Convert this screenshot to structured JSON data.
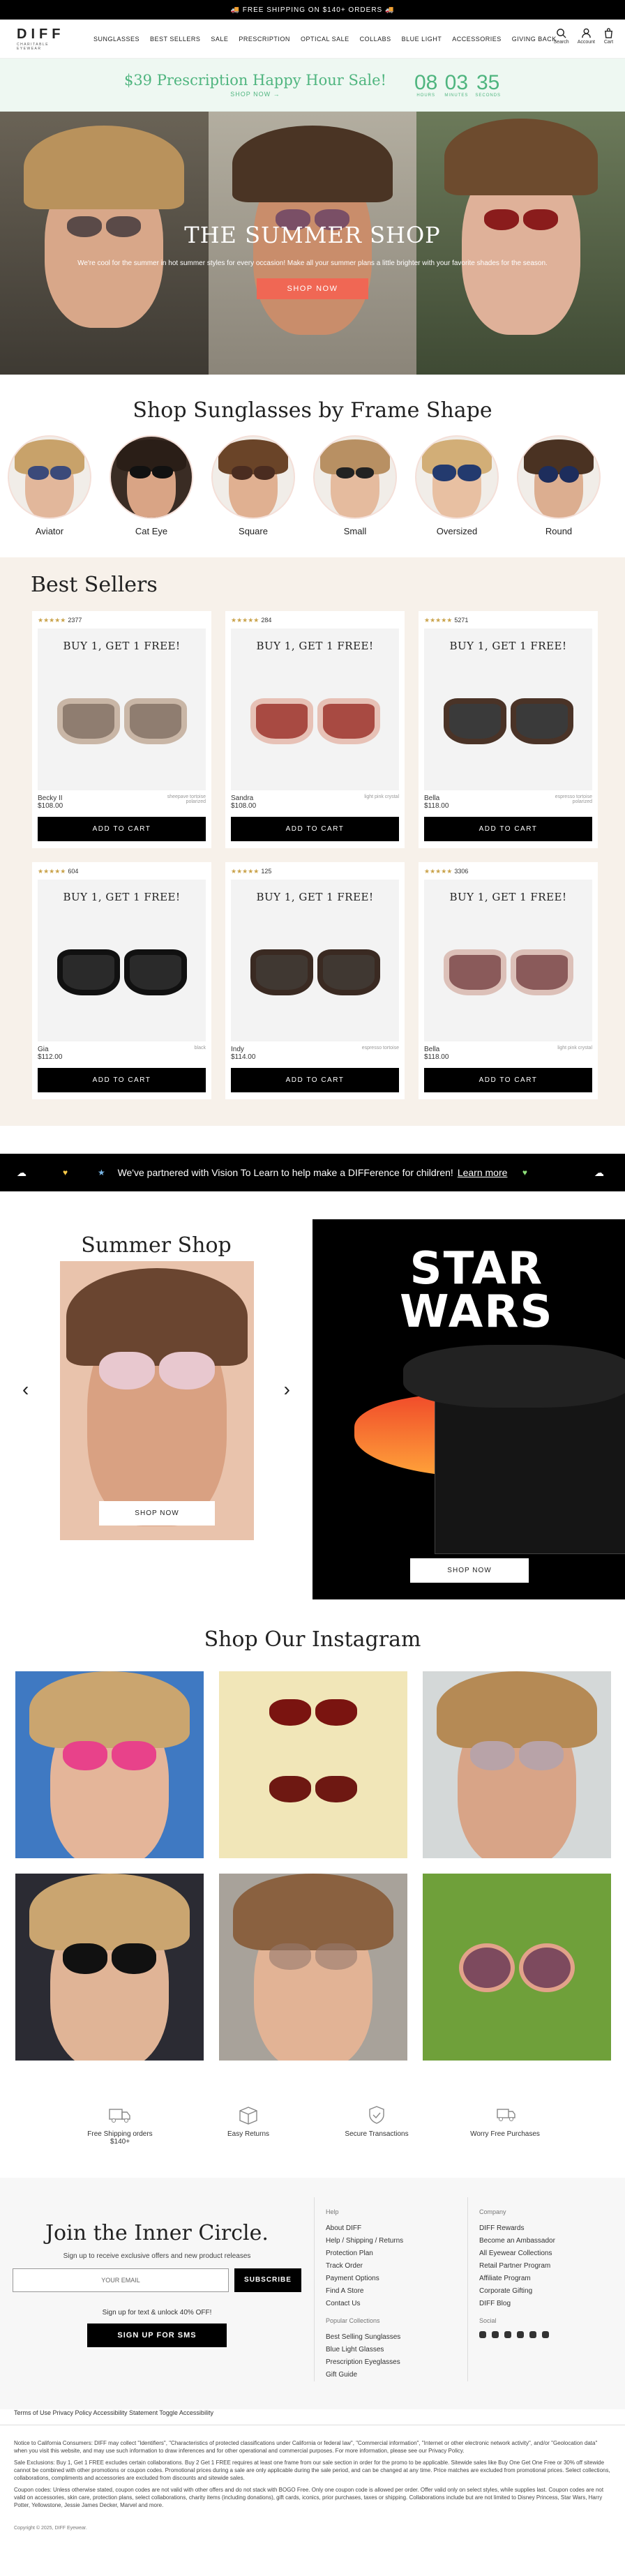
{
  "announcement": "🚚 FREE SHIPPING ON $140+ ORDERS 🚚",
  "brand": {
    "name": "DIFF",
    "tagline": "CHARITABLE EYEWEAR"
  },
  "nav": [
    "SUNGLASSES",
    "BEST SELLERS",
    "SALE",
    "PRESCRIPTION",
    "OPTICAL SALE",
    "COLLABS",
    "BLUE LIGHT",
    "ACCESSORIES",
    "GIVING BACK"
  ],
  "header_icons": {
    "search": "Search",
    "account": "Account",
    "cart": "Cart"
  },
  "promo": {
    "title": "$39 Prescription Happy Hour Sale!",
    "cta": "SHOP NOW →",
    "countdown": [
      {
        "n": "08",
        "l": "HOURS"
      },
      {
        "n": "03",
        "l": "MINUTES"
      },
      {
        "n": "35",
        "l": "SECONDS"
      }
    ]
  },
  "hero": {
    "title": "THE SUMMER SHOP",
    "text": "We're cool for the summer in hot summer styles for every occasion! Make all your summer plans a little brighter with your favorite shades for the season.",
    "button": "SHOP NOW"
  },
  "shapes": {
    "title": "Shop Sunglasses by Frame Shape",
    "items": [
      "Aviator",
      "Cat Eye",
      "Square",
      "Small",
      "Oversized",
      "Round"
    ]
  },
  "best": {
    "title": "Best Sellers",
    "products": [
      {
        "rating": "★★★★★",
        "reviews": "2377",
        "bogo": "BUY 1, GET 1 FREE!",
        "name": "Becky II",
        "price": "$108.00",
        "color": "sheepave tortoise polarized",
        "frame": "#c9b6a6",
        "lens": "#8f7d70"
      },
      {
        "rating": "★★★★★",
        "reviews": "284",
        "bogo": "BUY 1, GET 1 FREE!",
        "name": "Sandra",
        "price": "$108.00",
        "color": "light pink crystal",
        "frame": "#e7c1b6",
        "lens": "#a84a42"
      },
      {
        "rating": "★★★★★",
        "reviews": "5271",
        "bogo": "BUY 1, GET 1 FREE!",
        "name": "Bella",
        "price": "$118.00",
        "color": "espresso tortoise polarized",
        "frame": "#4a3327",
        "lens": "#3a3a3a"
      },
      {
        "rating": "★★★★★",
        "reviews": "604",
        "bogo": "BUY 1, GET 1 FREE!",
        "name": "Gia",
        "price": "$112.00",
        "color": "black",
        "frame": "#111",
        "lens": "#2a2a2a"
      },
      {
        "rating": "★★★★★",
        "reviews": "125",
        "bogo": "BUY 1, GET 1 FREE!",
        "name": "Indy",
        "price": "$114.00",
        "color": "espresso tortoise",
        "frame": "#3a2a22",
        "lens": "#403832"
      },
      {
        "rating": "★★★★★",
        "reviews": "3306",
        "bogo": "BUY 1, GET 1 FREE!",
        "name": "Bella",
        "price": "$118.00",
        "color": "light pink crystal",
        "frame": "#dcc0b8",
        "lens": "#8a5a5a"
      }
    ],
    "add_to_cart": "ADD TO CART"
  },
  "vision": {
    "text": "We've partnered with Vision To Learn to help make a DIFFerence for children!",
    "link": "Learn more"
  },
  "summer_shop": {
    "title": "Summer Shop",
    "button": "SHOP NOW"
  },
  "star_wars": {
    "logo_top": "STAR",
    "logo_bottom": "WARS",
    "button": "SHOP NOW"
  },
  "instagram": {
    "title": "Shop Our Instagram"
  },
  "features": [
    "Free Shipping orders $140+",
    "Easy Returns",
    "Secure Transactions",
    "Worry Free Purchases"
  ],
  "footer": {
    "join_title": "Join the Inner Circle.",
    "join_sub": "Sign up to receive exclusive offers and new product releases",
    "email_placeholder": "YOUR EMAIL",
    "subscribe": "SUBSCRIBE",
    "sms_text": "Sign up for text & unlock 40% OFF!",
    "sms_button": "SIGN UP FOR SMS",
    "help_title": "Help",
    "help": [
      "About DIFF",
      "Help / Shipping / Returns",
      "Protection Plan",
      "Track Order",
      "Payment Options",
      "Find A Store",
      "Contact Us"
    ],
    "popular_title": "Popular Collections",
    "popular": [
      "Best Selling Sunglasses",
      "Blue Light Glasses",
      "Prescription Eyeglasses",
      "Gift Guide"
    ],
    "company_title": "Company",
    "company": [
      "DIFF Rewards",
      "Become an Ambassador",
      "All Eyewear Collections",
      "Retail Partner Program",
      "Affiliate Program",
      "Corporate Gifting",
      "DIFF Blog"
    ],
    "social_title": "Social"
  },
  "legal": {
    "links": "Terms of Use  Privacy Policy  Accessibility Statement  Toggle Accessibility",
    "notice": "Notice to California Consumers: DIFF may collect \"Identifiers\", \"Characteristics of protected classifications under California or federal law\", \"Commercial information\", \"Internet or other electronic network activity\", and/or \"Geolocation data\" when you visit this website, and may use such information to draw inferences and for other operational and commercial purposes. For more information, please see our Privacy Policy.",
    "sale": "Sale Exclusions: Buy 1, Get 1 FREE excludes certain collaborations. Buy 2 Get 1 FREE requires at least one frame from our sale section in order for the promo to be applicable. Sitewide sales like Buy One Get One Free or 30% off sitewide cannot be combined with other promotions or coupon codes. Promotional prices during a sale are only applicable during the sale period, and can be changed at any time. Price matches are excluded from promotional prices. Select collections, collaborations, compliments and accessories are excluded from discounts and sitewide sales.",
    "coupon": "Coupon codes: Unless otherwise stated, coupon codes are not valid with other offers and do not stack with BOGO Free. Only one coupon code is allowed per order. Offer valid only on select styles, while supplies last. Coupon codes are not valid on accessories, skin care, protection plans, select collaborations, charity items (including donations), gift cards, iconics, prior purchases, taxes or shipping. Collaborations include but are not limited to Disney Princess, Star Wars, Harry Potter, Yellowstone, Jessie James Decker, Marvel and more.",
    "copyright": "Copyright © 2025, DIFF Eyewear."
  }
}
